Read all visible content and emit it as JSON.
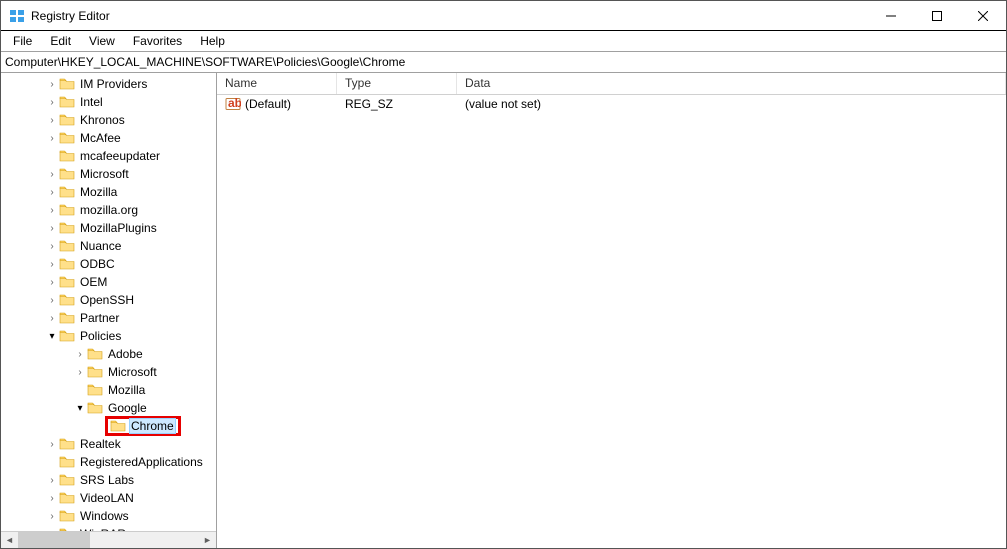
{
  "window": {
    "title": "Registry Editor"
  },
  "menu": {
    "file": "File",
    "edit": "Edit",
    "view": "View",
    "favorites": "Favorites",
    "help": "Help"
  },
  "address": {
    "path": "Computer\\HKEY_LOCAL_MACHINE\\SOFTWARE\\Policies\\Google\\Chrome"
  },
  "tree": {
    "level2": [
      {
        "label": "IM Providers",
        "chev": "closed"
      },
      {
        "label": "Intel",
        "chev": "closed"
      },
      {
        "label": "Khronos",
        "chev": "closed"
      },
      {
        "label": "McAfee",
        "chev": "closed"
      },
      {
        "label": "mcafeeupdater",
        "chev": "none"
      },
      {
        "label": "Microsoft",
        "chev": "closed"
      },
      {
        "label": "Mozilla",
        "chev": "closed"
      },
      {
        "label": "mozilla.org",
        "chev": "closed"
      },
      {
        "label": "MozillaPlugins",
        "chev": "closed"
      },
      {
        "label": "Nuance",
        "chev": "closed"
      },
      {
        "label": "ODBC",
        "chev": "closed"
      },
      {
        "label": "OEM",
        "chev": "closed"
      },
      {
        "label": "OpenSSH",
        "chev": "closed"
      },
      {
        "label": "Partner",
        "chev": "closed"
      },
      {
        "label": "Policies",
        "chev": "open"
      }
    ],
    "policies_children": [
      {
        "label": "Adobe",
        "chev": "closed"
      },
      {
        "label": "Microsoft",
        "chev": "closed"
      },
      {
        "label": "Mozilla",
        "chev": "none"
      },
      {
        "label": "Google",
        "chev": "open"
      }
    ],
    "google_child": {
      "label": "Chrome"
    },
    "after_policies": [
      {
        "label": "Realtek",
        "chev": "closed"
      },
      {
        "label": "RegisteredApplications",
        "chev": "none"
      },
      {
        "label": "SRS Labs",
        "chev": "closed"
      },
      {
        "label": "VideoLAN",
        "chev": "closed"
      },
      {
        "label": "Windows",
        "chev": "closed"
      },
      {
        "label": "WinRAR",
        "chev": "closed"
      }
    ]
  },
  "list": {
    "columns": {
      "name": "Name",
      "type": "Type",
      "data": "Data"
    },
    "rows": [
      {
        "name": "(Default)",
        "type": "REG_SZ",
        "data": "(value not set)"
      }
    ]
  }
}
